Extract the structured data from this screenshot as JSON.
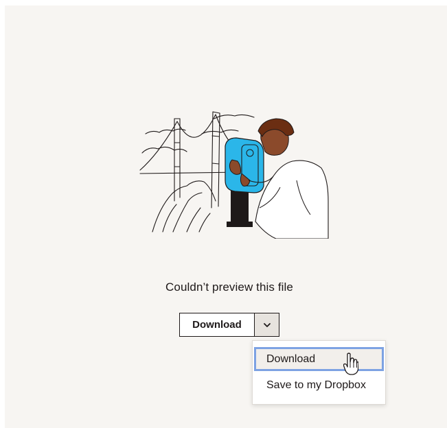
{
  "preview": {
    "message": "Couldn’t preview this file"
  },
  "actions": {
    "download_label": "Download",
    "caret_icon": "chevron-down-icon"
  },
  "dropdown": {
    "items": [
      {
        "label": "Download",
        "active": true
      },
      {
        "label": "Save to my Dropbox",
        "active": false
      }
    ]
  },
  "colors": {
    "background": "#f7f5f2",
    "text": "#1e1919",
    "accent_blue": "#2bb6e9",
    "focus_ring": "#7da2e3"
  }
}
